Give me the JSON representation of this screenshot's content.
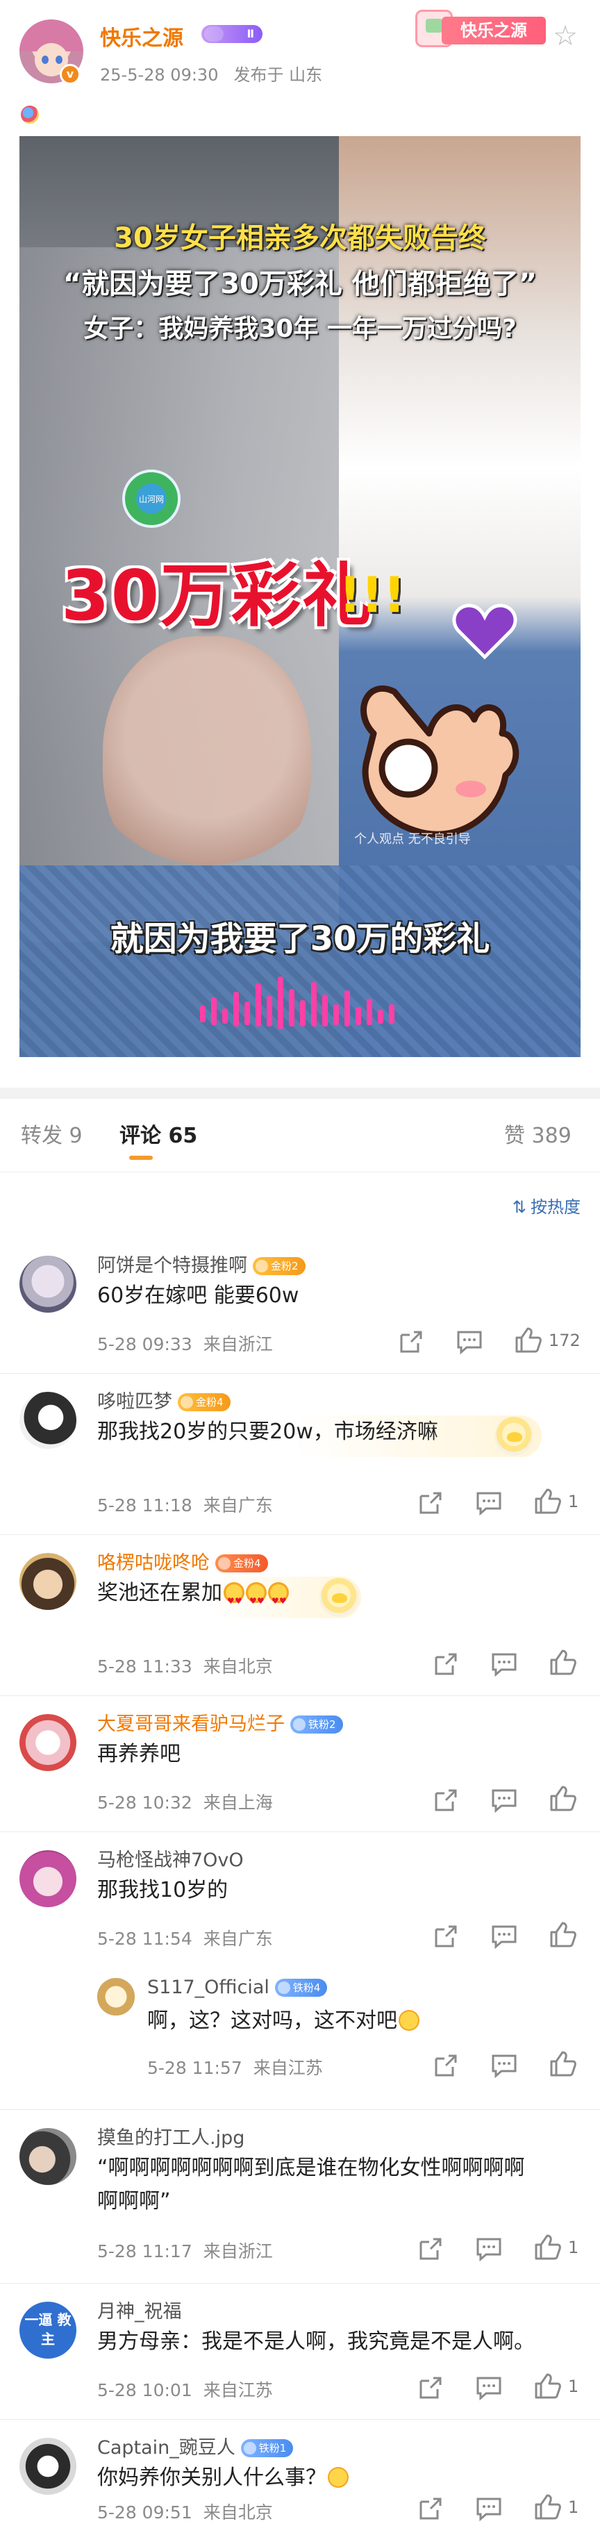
{
  "post": {
    "author": "快乐之源",
    "member_level": "Ⅱ",
    "verified_mark": "v",
    "date": "25-5-28 09:30",
    "location": "发布于 山东",
    "fan_card_label": "快乐之源"
  },
  "video": {
    "line1": "30岁女子相亲多次都失败告终",
    "line2": "“就因为要了30万彩礼 他们都拒绝了”",
    "line3": "女子：我妈养我30年 一年一万过分吗?",
    "logo_text": "山河网",
    "big_caption": "30万彩礼",
    "exclaim": "!!!",
    "watermark": "个人观点 无不良引导",
    "subtitle": "就因为我要了30万的彩礼"
  },
  "tabs": {
    "repost": "转发 9",
    "comments": "评论 65",
    "likes": "赞 389"
  },
  "sort_label": "按热度",
  "comments": [
    {
      "name": "阿饼是个特摄推啊",
      "badge": "金粉2",
      "text": "60岁在嫁吧 能要60w",
      "date": "5-28 09:33",
      "from": "来自浙江",
      "likes": "172"
    },
    {
      "name": "哆啦匹梦",
      "badge": "金粉4",
      "text": "那我找20岁的只要20w，市场经济嘛",
      "date": "5-28 11:18",
      "from": "来自广东",
      "likes": "1"
    },
    {
      "name": "咯楞咕咙咚呛",
      "badge": "金粉4",
      "text": "奖池还在累加",
      "date": "5-28 11:33",
      "from": "来自北京",
      "likes": ""
    },
    {
      "name": "大夏哥哥来看驴马烂子",
      "badge": "铁粉2",
      "text": "再养养吧",
      "date": "5-28 10:32",
      "from": "来自上海",
      "likes": ""
    },
    {
      "name": "马枪怪战神7OvO",
      "badge": "",
      "text": "那我找10岁的",
      "date": "5-28 11:54",
      "from": "来自广东",
      "likes": "",
      "reply": {
        "name": "S117_Official",
        "badge": "铁粉4",
        "text": "啊，这？这对吗，这不对吧",
        "date": "5-28 11:57",
        "from": "来自江苏"
      }
    },
    {
      "name": "摸鱼的打工人.jpg",
      "badge": "",
      "text_l1": "“啊啊啊啊啊啊啊到底是谁在物化女性啊啊啊啊",
      "text_l2": "啊啊啊”",
      "date": "5-28 11:17",
      "from": "来自浙江",
      "likes": "1"
    },
    {
      "name": "月神_祝福",
      "badge": "",
      "avatar_text": "一逼 教主",
      "text": "男方母亲：我是不是人啊，我究竟是不是人啊。",
      "date": "5-28 10:01",
      "from": "来自江苏",
      "likes": "1"
    },
    {
      "name": "Captain_豌豆人",
      "badge": "铁粉1",
      "text": "你妈养你关别人什么事？",
      "date": "5-28 09:51",
      "from": "来自北京",
      "likes": "1"
    }
  ],
  "colors": {
    "accent_orange": "#f07800",
    "link_blue": "#3a6fb5"
  }
}
